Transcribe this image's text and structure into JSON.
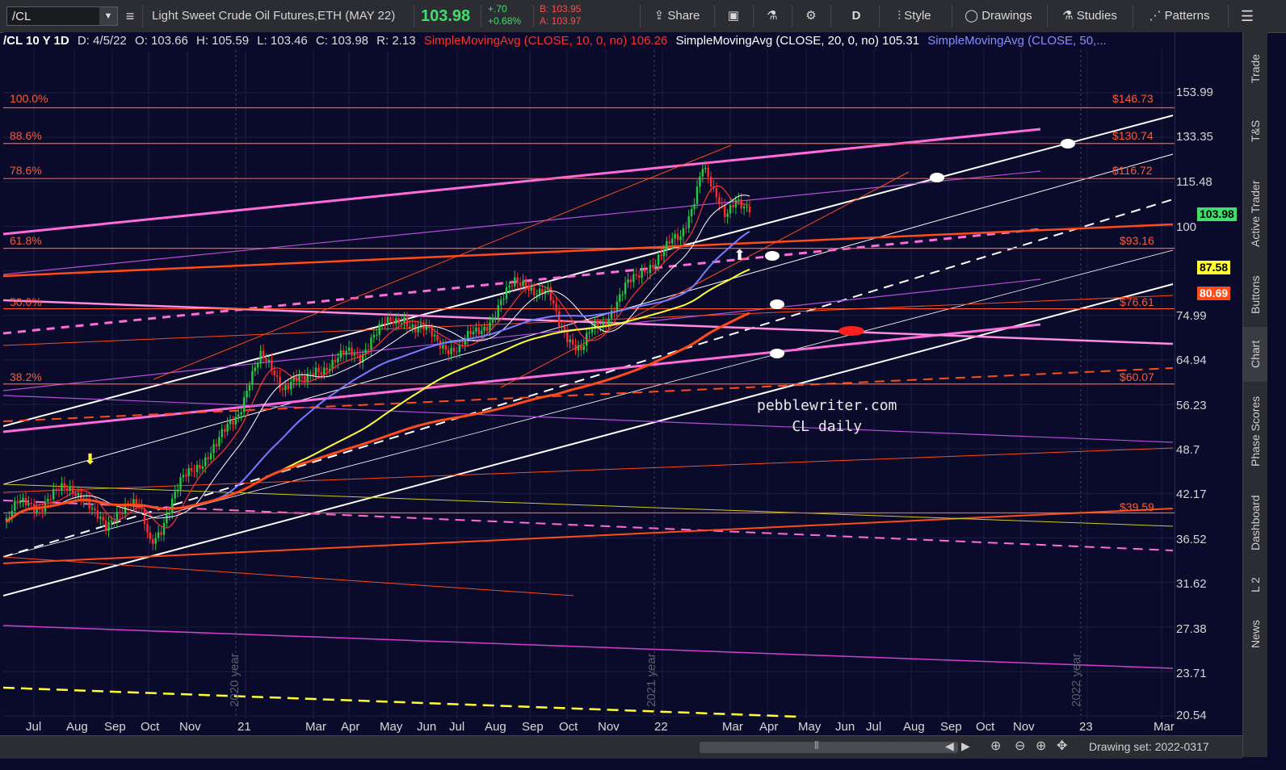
{
  "toolbar": {
    "symbol": "/CL",
    "description": "Light Sweet Crude Oil Futures,ETH (MAY 22)",
    "last": "103.98",
    "change": "+.70",
    "change_pct": "+0.68%",
    "bid": "B: 103.95",
    "ask": "A: 103.97",
    "share": "Share",
    "aggregation": "D",
    "style": "Style",
    "drawings": "Drawings",
    "studies": "Studies",
    "patterns": "Patterns"
  },
  "legend": {
    "header": "/CL 10 Y 1D",
    "date": "D: 4/5/22",
    "open": "O: 103.66",
    "high": "H: 105.59",
    "low": "L: 103.46",
    "close": "C: 103.98",
    "range": "R: 2.13",
    "sma10": "SimpleMovingAvg (CLOSE, 10, 0, no)",
    "sma10_val": "106.26",
    "sma20": "SimpleMovingAvg (CLOSE, 20, 0, no)",
    "sma20_val": "105.31",
    "sma50": "SimpleMovingAvg (CLOSE, 50,..."
  },
  "side_tabs": [
    "Trade",
    "T&S",
    "Active Trader",
    "Buttons",
    "Chart",
    "Phase Scores",
    "Dashboard",
    "L 2",
    "News"
  ],
  "status": {
    "drawing_set": "Drawing set: 2022-0317"
  },
  "watermark": {
    "line1": "pebblewriter.com",
    "line2": "CL daily"
  },
  "colors": {
    "background": "#0a0b2a",
    "up": "#26c940",
    "down": "#ff2a2a",
    "fib": "#ff5a36",
    "pink": "#ff6bd8",
    "sma10": "#ff3030",
    "sma20": "#ffffff",
    "sma50": "#7a7cff",
    "sma_yellow": "#ffff33",
    "sma_orange": "#ff4a1a"
  },
  "chart_data": {
    "type": "candlestick",
    "title": "/CL 10 Y 1D",
    "y_scale": "log",
    "y_ticks": [
      153.99,
      133.35,
      115.48,
      100,
      86.6,
      74.99,
      64.94,
      56.23,
      48.7,
      42.17,
      36.52,
      31.62,
      27.38,
      23.71,
      20.54
    ],
    "y_tick_labels": [
      "153.99",
      "133.35",
      "115.48",
      "100",
      "",
      "74.99",
      "64.94",
      "56.23",
      "48.7",
      "42.17",
      "36.52",
      "31.62",
      "27.38",
      "23.71",
      "20.54"
    ],
    "x_labels": [
      "Jul",
      "Aug",
      "Sep",
      "Oct",
      "Nov",
      "21",
      "Mar",
      "Apr",
      "May",
      "Jun",
      "Jul",
      "Aug",
      "Sep",
      "Oct",
      "Nov",
      "22",
      "Mar",
      "Apr",
      "May",
      "Jun",
      "Jul",
      "Aug",
      "Sep",
      "Oct",
      "Nov",
      "23",
      "Mar"
    ],
    "year_markers": [
      "2020 year",
      "2021 year",
      "2022 year"
    ],
    "fib_levels": [
      {
        "pct": "100.0%",
        "value": 146.73,
        "label": "$146.73"
      },
      {
        "pct": "88.6%",
        "value": 130.74,
        "label": "$130.74"
      },
      {
        "pct": "78.6%",
        "value": 116.72,
        "label": "$116.72"
      },
      {
        "pct": "61.8%",
        "value": 93.16,
        "label": "$93.16"
      },
      {
        "pct": "50.0%",
        "value": 76.61,
        "label": "$76.61"
      },
      {
        "pct": "38.2%",
        "value": 60.07,
        "label": "$60.07"
      },
      {
        "pct": "",
        "value": 39.59,
        "label": "$39.59"
      }
    ],
    "price_badges": [
      {
        "value": 103.98,
        "label": "103.98",
        "color": "#3ee06a"
      },
      {
        "value": 87.58,
        "label": "87.58",
        "color": "#ffff33"
      },
      {
        "value": 80.69,
        "label": "80.69",
        "color": "#ff4a1a"
      }
    ],
    "close_series": [
      [
        0,
        38.5
      ],
      [
        4,
        40.5
      ],
      [
        8,
        41
      ],
      [
        12,
        40.5
      ],
      [
        16,
        41.5
      ],
      [
        20,
        42.5
      ],
      [
        24,
        43
      ],
      [
        28,
        42
      ],
      [
        32,
        39
      ],
      [
        36,
        37.5
      ],
      [
        40,
        40
      ],
      [
        44,
        41
      ],
      [
        48,
        40
      ],
      [
        52,
        36
      ],
      [
        56,
        38
      ],
      [
        60,
        41
      ],
      [
        64,
        44
      ],
      [
        68,
        46
      ],
      [
        72,
        47.5
      ],
      [
        76,
        49
      ],
      [
        80,
        52
      ],
      [
        84,
        55
      ],
      [
        88,
        61
      ],
      [
        92,
        65
      ],
      [
        96,
        63
      ],
      [
        100,
        60
      ],
      [
        104,
        61
      ],
      [
        108,
        60
      ],
      [
        112,
        63
      ],
      [
        116,
        64
      ],
      [
        120,
        65
      ],
      [
        124,
        66
      ],
      [
        128,
        66
      ],
      [
        132,
        70
      ],
      [
        136,
        72
      ],
      [
        140,
        73
      ],
      [
        144,
        75
      ],
      [
        148,
        72
      ],
      [
        152,
        71
      ],
      [
        156,
        69
      ],
      [
        160,
        68
      ],
      [
        164,
        67
      ],
      [
        168,
        70
      ],
      [
        172,
        72
      ],
      [
        176,
        75
      ],
      [
        180,
        79
      ],
      [
        184,
        83
      ],
      [
        188,
        84
      ],
      [
        192,
        81
      ],
      [
        196,
        80
      ],
      [
        200,
        73
      ],
      [
        204,
        70
      ],
      [
        208,
        67
      ],
      [
        212,
        71
      ],
      [
        216,
        73
      ],
      [
        220,
        78
      ],
      [
        224,
        82
      ],
      [
        228,
        84
      ],
      [
        232,
        88
      ],
      [
        236,
        91
      ],
      [
        240,
        94
      ],
      [
        244,
        96
      ],
      [
        248,
        107
      ],
      [
        252,
        122
      ],
      [
        256,
        110
      ],
      [
        260,
        104
      ],
      [
        264,
        111
      ],
      [
        268,
        105
      ],
      [
        270,
        104
      ]
    ],
    "annotations": [
      "pebblewriter.com",
      "CL daily"
    ]
  }
}
